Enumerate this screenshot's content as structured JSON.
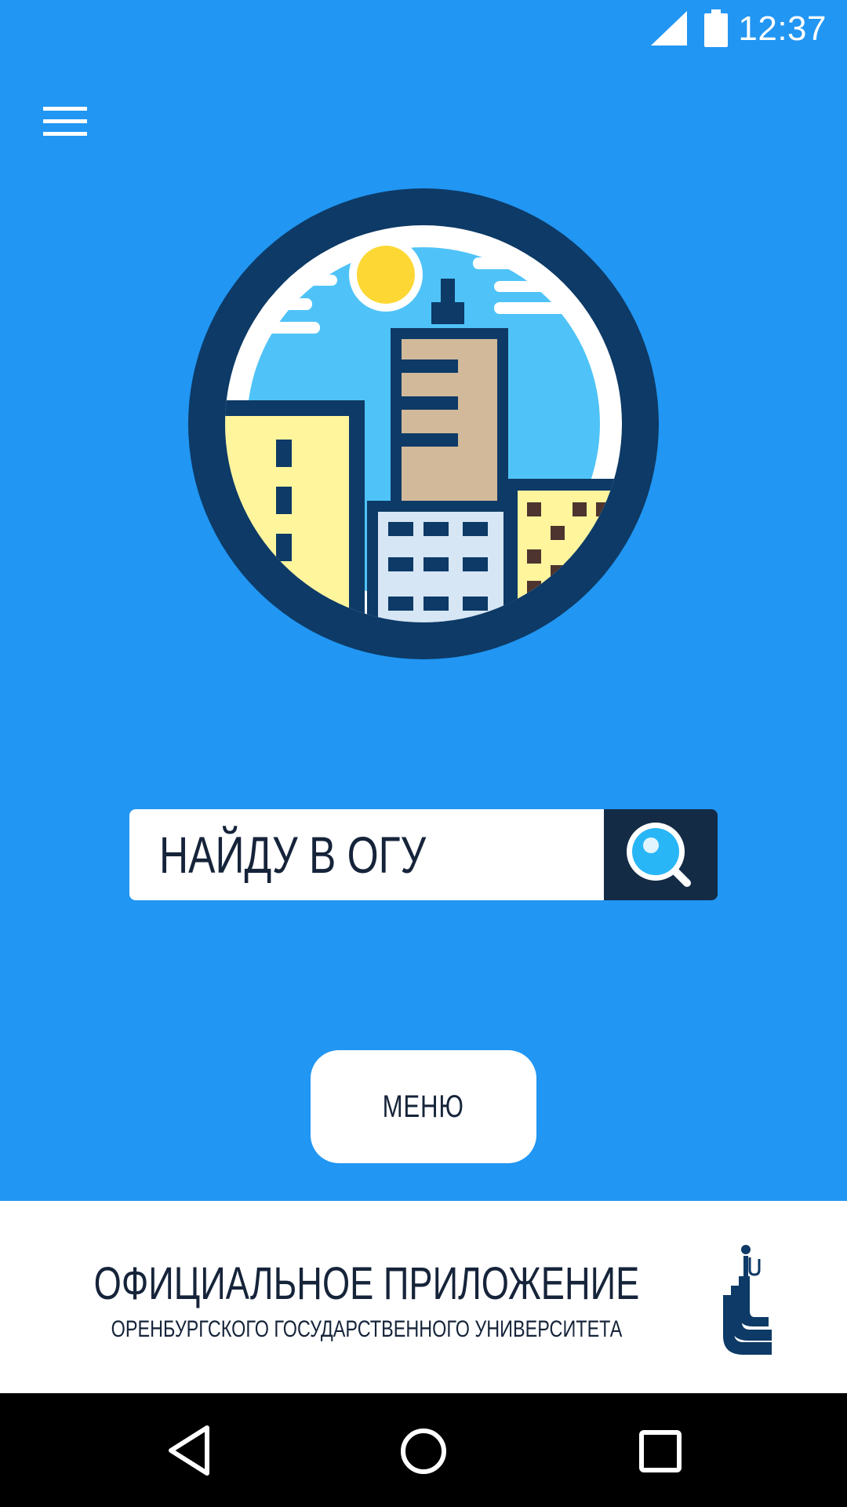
{
  "status_bar": {
    "time": "12:37",
    "icons": [
      "signal-icon",
      "battery-icon"
    ]
  },
  "header": {
    "menu_icon": "hamburger-menu-icon"
  },
  "hero": {
    "image": "city-buildings-logo"
  },
  "search": {
    "text": "НАЙДУ В ОГУ",
    "button_icon": "search-icon"
  },
  "menu_button": {
    "label": "МЕНЮ"
  },
  "footer": {
    "title": "ОФИЦИАЛЬНОЕ ПРИЛОЖЕНИЕ",
    "subtitle": "ОРЕНБУРГСКОГО ГОСУДАРСТВЕННОГО УНИВЕРСИТЕТА",
    "logo": "osu-university-logo"
  },
  "nav": {
    "icons": [
      "back-icon",
      "home-icon",
      "recents-icon"
    ]
  },
  "colors": {
    "background": "#2196F3",
    "dark_navy": "#0D3A66",
    "search_button": "#132b45",
    "text_dark": "#16243a"
  }
}
